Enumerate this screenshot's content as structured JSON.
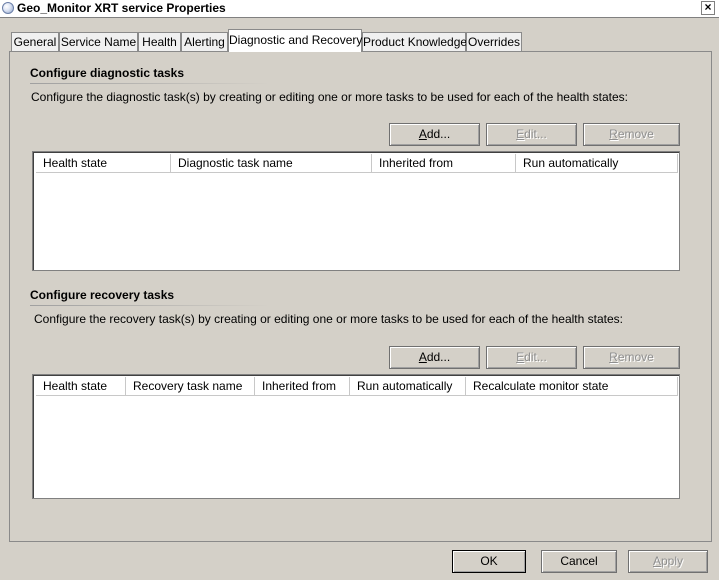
{
  "window": {
    "title": "Geo_Monitor XRT service Properties",
    "close_glyph": "×"
  },
  "tabs": [
    {
      "label": "General"
    },
    {
      "label": "Service Name"
    },
    {
      "label": "Health"
    },
    {
      "label": "Alerting"
    },
    {
      "label": "Diagnostic and Recovery",
      "active": true
    },
    {
      "label": "Product Knowledge"
    },
    {
      "label": "Overrides"
    }
  ],
  "diagnostic": {
    "title": "Configure diagnostic tasks",
    "description": "Configure the diagnostic task(s) by creating or editing one or more tasks to be used for each of the health states:",
    "add_label": "Add...",
    "edit_label": "Edit...",
    "remove_label": "Remove",
    "columns": [
      "Health state",
      "Diagnostic task name",
      "Inherited from",
      "Run automatically"
    ],
    "rows": []
  },
  "recovery": {
    "title": "Configure recovery tasks",
    "description": "Configure the recovery task(s) by creating or editing one or more tasks to be used for each of the health states:",
    "add_label": "Add...",
    "edit_label": "Edit...",
    "remove_label": "Remove",
    "columns": [
      "Health state",
      "Recovery task name",
      "Inherited from",
      "Run automatically",
      "Recalculate monitor state"
    ],
    "rows": []
  },
  "footer": {
    "ok_label": "OK",
    "cancel_label": "Cancel",
    "apply_label": "Apply"
  }
}
